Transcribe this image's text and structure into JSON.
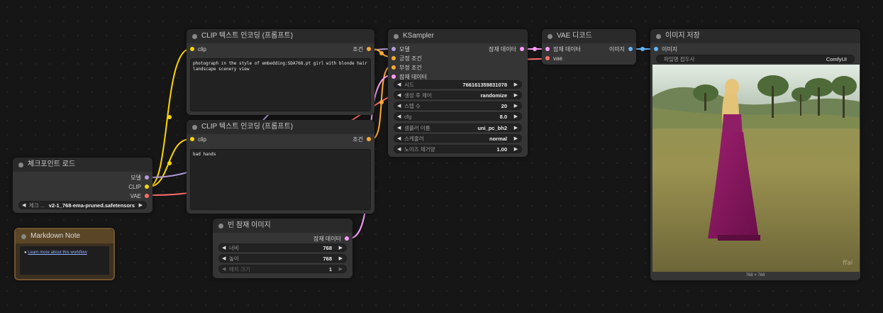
{
  "colors": {
    "clip": "#ffd500",
    "model": "#b39ddb",
    "vae": "#ff6e6e",
    "conditioning": "#ffa931",
    "latent": "#ff9cf9",
    "image": "#64b5f6"
  },
  "clip_pos": {
    "title": "CLIP 텍스트 인코딩 (프롬프트)",
    "in_label": "clip",
    "out_label": "조건",
    "text": "photograph in the style of embedding:SDA768.pt girl with blonde hair landscape scenery view"
  },
  "clip_neg": {
    "title": "CLIP 텍스트 인코딩 (프롬프트)",
    "in_label": "clip",
    "out_label": "조건",
    "text": "bad hands"
  },
  "ksampler": {
    "title": "KSampler",
    "inputs": [
      "모델",
      "긍정 조건",
      "부정 조건",
      "잠재 데이터"
    ],
    "out_label": "잠재 데이터",
    "widgets": [
      {
        "label": "시드",
        "value": "766161359831078"
      },
      {
        "label": "생성 후 제어",
        "value": "randomize"
      },
      {
        "label": "스텝 수",
        "value": "20"
      },
      {
        "label": "cfg",
        "value": "8.0"
      },
      {
        "label": "샘플러 이름",
        "value": "uni_pc_bh2"
      },
      {
        "label": "스케줄러",
        "value": "normal"
      },
      {
        "label": "노이즈 제거양",
        "value": "1.00"
      }
    ]
  },
  "vae_decode": {
    "title": "VAE 디코드",
    "inputs": [
      "잠재 데이터",
      "vae"
    ],
    "out_label": "이미지"
  },
  "save_image": {
    "title": "이미지 저장",
    "in_label": "이미지",
    "widget_label": "파일명 접두사",
    "widget_value": "ComfyUI",
    "caption": "768 × 768"
  },
  "checkpoint": {
    "title": "체크포인트 로드",
    "outputs": [
      "모델",
      "CLIP",
      "VAE"
    ],
    "widget_label": "체크 ...",
    "widget_value": "v2-1_768-ema-pruned.safetensors"
  },
  "empty_latent": {
    "title": "빈 잠재 이미지",
    "out_label": "잠재 데이터",
    "widgets": [
      {
        "label": "너비",
        "value": "768"
      },
      {
        "label": "높이",
        "value": "768"
      },
      {
        "label": "배치 크기",
        "value": "1"
      }
    ]
  },
  "markdown_note": {
    "title": "Markdown Note",
    "link_text": "Learn more about this workflow"
  }
}
